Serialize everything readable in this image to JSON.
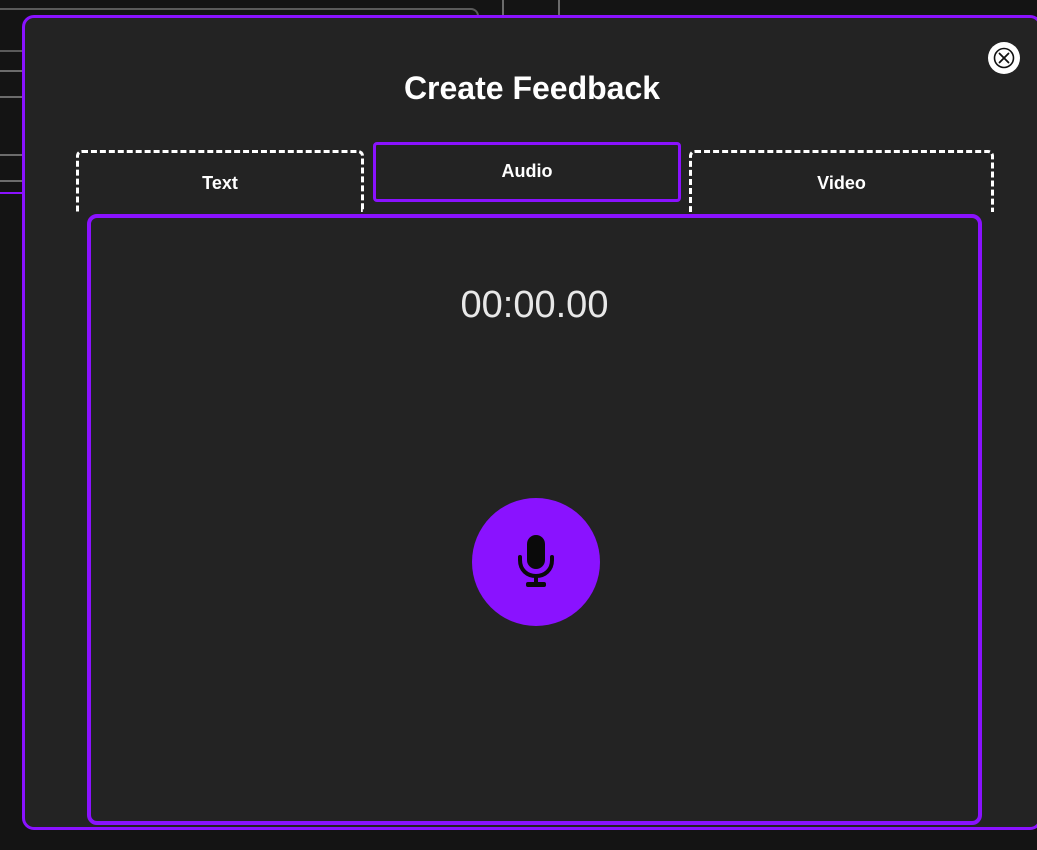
{
  "modal": {
    "title": "Create Feedback"
  },
  "tabs": [
    {
      "label": "Text",
      "active": false
    },
    {
      "label": "Audio",
      "active": true
    },
    {
      "label": "Video",
      "active": false
    }
  ],
  "recorder": {
    "timer": "00:00.00",
    "record_icon": "microphone-icon"
  },
  "close_icon": "close-icon",
  "colors": {
    "accent": "#8a12ff",
    "modal_background": "#232323",
    "page_background": "#141414",
    "text": "#ffffff"
  }
}
